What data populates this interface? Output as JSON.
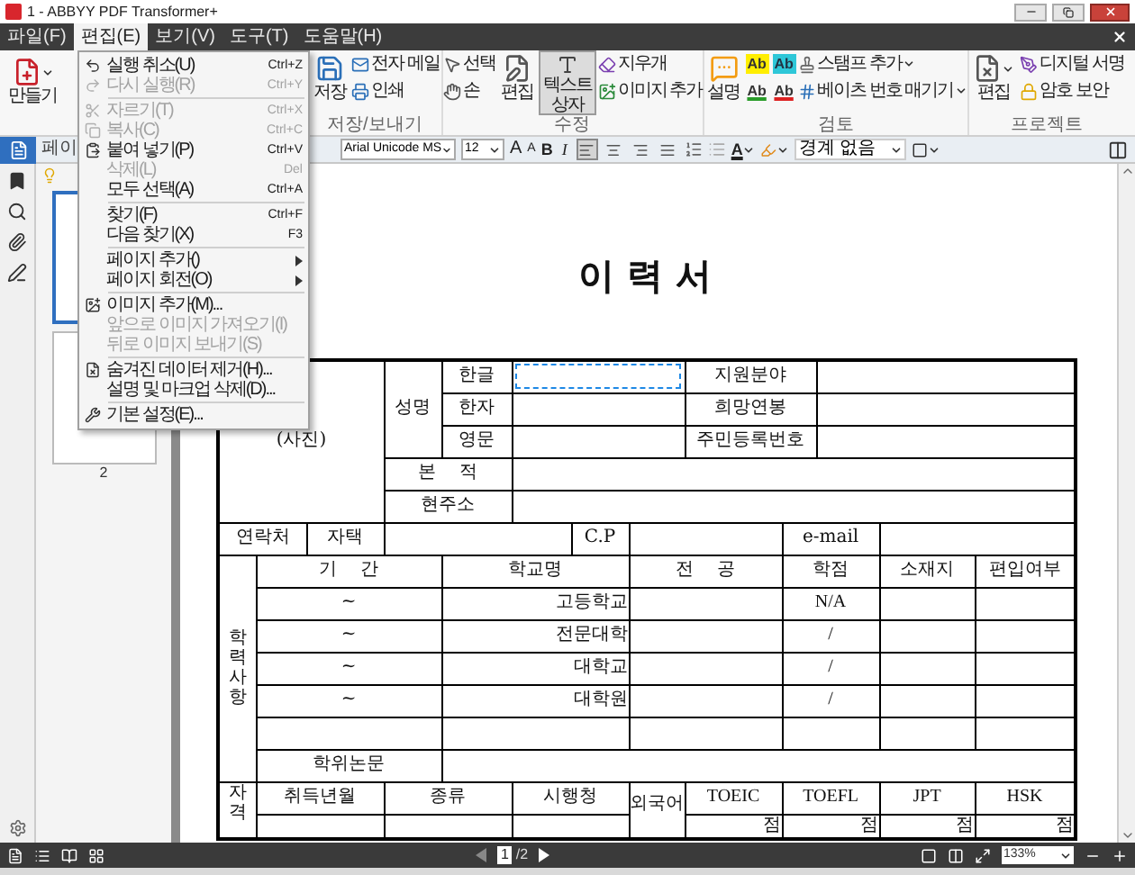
{
  "window": {
    "title": "1 - ABBYY PDF Transformer+"
  },
  "menu_bar": [
    {
      "label": "파일(F)",
      "selected": false
    },
    {
      "label": "편집(E)",
      "selected": true
    },
    {
      "label": "보기(V)",
      "selected": false
    },
    {
      "label": "도구(T)",
      "selected": false
    },
    {
      "label": "도움말(H)",
      "selected": false
    }
  ],
  "edit_menu": [
    {
      "kind": "item",
      "label": "실행 취소(U)",
      "shortcut": "Ctrl+Z",
      "disabled": false
    },
    {
      "kind": "item",
      "label": "다시 실행(R)",
      "shortcut": "Ctrl+Y",
      "disabled": true
    },
    {
      "kind": "separator"
    },
    {
      "kind": "item",
      "label": "자르기(T)",
      "shortcut": "Ctrl+X",
      "disabled": true
    },
    {
      "kind": "item",
      "label": "복사(C)",
      "shortcut": "Ctrl+C",
      "disabled": true
    },
    {
      "kind": "item",
      "label": "붙여 넣기(P)",
      "shortcut": "Ctrl+V",
      "disabled": false
    },
    {
      "kind": "item",
      "label": "삭제(L)",
      "shortcut": "Del",
      "disabled": true
    },
    {
      "kind": "item",
      "label": "모두 선택(A)",
      "shortcut": "Ctrl+A",
      "disabled": false
    },
    {
      "kind": "separator"
    },
    {
      "kind": "item",
      "label": "찾기(F)",
      "shortcut": "Ctrl+F",
      "disabled": false
    },
    {
      "kind": "item",
      "label": "다음 찾기(X)",
      "shortcut": "F3",
      "disabled": false
    },
    {
      "kind": "separator"
    },
    {
      "kind": "item",
      "label": "페이지 추가()",
      "submenu": true,
      "disabled": false
    },
    {
      "kind": "item",
      "label": "페이지 회전(O)",
      "submenu": true,
      "disabled": false
    },
    {
      "kind": "separator"
    },
    {
      "kind": "item",
      "label": "이미지 추가(M)...",
      "disabled": false
    },
    {
      "kind": "item",
      "label": "앞으로 이미지 가져오기(I)",
      "disabled": true
    },
    {
      "kind": "item",
      "label": "뒤로 이미지 보내기(S)",
      "disabled": true
    },
    {
      "kind": "separator"
    },
    {
      "kind": "item",
      "label": "숨겨진 데이터 제거(H)...",
      "disabled": false
    },
    {
      "kind": "item",
      "label": "설명 및 마크업 삭제(D)...",
      "disabled": false
    },
    {
      "kind": "separator"
    },
    {
      "kind": "item",
      "label": "기본 설정(E)...",
      "disabled": false
    }
  ],
  "ribbon": {
    "create": "만들기",
    "save": "저장",
    "email": "전자 메일",
    "print": "인쇄",
    "select": "선택",
    "hand": "손",
    "edit": "편집",
    "text_box": {
      "label": "텍스트 상자",
      "selected": true
    },
    "eraser": "지우개",
    "add_image": "이미지 추가",
    "note": "설명",
    "markup_tools": [
      {
        "kind": "highlight",
        "label": "Ab"
      },
      {
        "kind": "insert",
        "label": "Ab"
      },
      {
        "kind": "underline",
        "label": "Ab"
      },
      {
        "kind": "strikeout",
        "label": "Ab"
      }
    ],
    "stamp": "스탬프 추가",
    "bates": "베이츠 번호 매기기",
    "project_edit": "편집",
    "digital_signature": "디지털 서명",
    "password": "암호 보안",
    "groups": [
      "저장/보내기",
      "수정",
      "검토",
      "프로젝트"
    ]
  },
  "format_toolbar": {
    "font": "Arial Unicode MS",
    "size": "12",
    "grow": "A",
    "shrink": "A",
    "bold": "B",
    "italic": "I",
    "alignments": [
      {
        "selected": true
      },
      {
        "selected": false
      },
      {
        "selected": false
      },
      {
        "selected": false
      }
    ],
    "text_color": "A",
    "border": "경계 없음"
  },
  "pages_panel": {
    "title": "페이",
    "thumbnails": [
      {
        "selected": true
      },
      {
        "label": "2",
        "selected": false
      }
    ]
  },
  "resume": {
    "title": "이 력 서",
    "photo": "(사진)",
    "name_label": "성명",
    "name_rows": [
      {
        "label": "한글",
        "selected": true,
        "field": "지원분야"
      },
      {
        "label": "한자",
        "selected": false,
        "field": "희망연봉"
      },
      {
        "label": "영문",
        "selected": false,
        "field": "주민등록번호"
      }
    ],
    "address_rows": [
      "본    적",
      "현주소"
    ],
    "contact": {
      "label": "연락처",
      "home": "자택",
      "mobile": "C.P",
      "email": "e-mail"
    },
    "education": {
      "label": "학력사항",
      "columns": [
        "기    간",
        "학교명",
        "전    공",
        "학점",
        "소재지",
        "편입여부"
      ],
      "rows": [
        {
          "period": "~",
          "school": "고등학교",
          "grade": "N/A"
        },
        {
          "period": "~",
          "school": "전문대학",
          "grade": "/"
        },
        {
          "period": "~",
          "school": "대학교",
          "grade": "/"
        },
        {
          "period": "~",
          "school": "대학원",
          "grade": "/"
        }
      ],
      "thesis": "학위논문"
    },
    "certificates": {
      "label": "자격",
      "columns": [
        "취득년월",
        "종류",
        "시행청"
      ],
      "language_label": "외국어",
      "tests": [
        "TOEIC",
        "TOEFL",
        "JPT",
        "HSK"
      ],
      "scores": [
        "점",
        "점",
        "점",
        "점"
      ]
    }
  },
  "status_bar": {
    "page": "1",
    "total": "/2",
    "zoom": "133%"
  }
}
